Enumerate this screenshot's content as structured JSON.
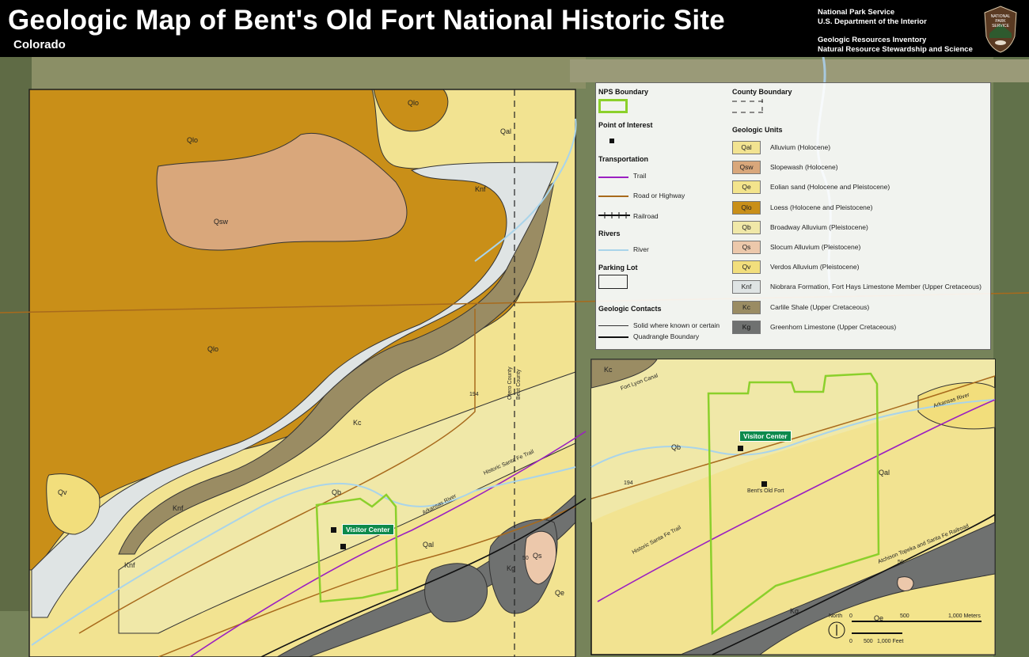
{
  "header": {
    "title": "Geologic Map of Bent's Old Fort National Historic Site",
    "subtitle": "Colorado",
    "agency_lines": [
      "National Park Service",
      "U.S. Department of the Interior"
    ],
    "program_lines": [
      "Geologic Resources Inventory",
      "Natural Resource Stewardship and Science"
    ],
    "badge_lines": [
      "NATIONAL",
      "PARK",
      "SERVICE"
    ]
  },
  "legend": {
    "nps_boundary": "NPS Boundary",
    "county_boundary": "County Boundary",
    "point_of_interest": "Point of Interest",
    "transportation": "Transportation",
    "trail": "Trail",
    "road": "Road or Highway",
    "railroad": "Railroad",
    "rivers": "Rivers",
    "river": "River",
    "parking_lot": "Parking Lot",
    "geologic_contacts": "Geologic Contacts",
    "contact_solid": "Solid where known or certain",
    "quadrangle": "Quadrangle Boundary",
    "geologic_units_title": "Geologic Units",
    "units": [
      {
        "code": "Qal",
        "desc": "Alluvium (Holocene)",
        "color": "#f2e391"
      },
      {
        "code": "Qsw",
        "desc": "Slopewash (Holocene)",
        "color": "#d9a77b"
      },
      {
        "code": "Qe",
        "desc": "Eolian sand (Holocene and Pleistocene)",
        "color": "#f3e48c"
      },
      {
        "code": "Qlo",
        "desc": "Loess (Holocene and Pleistocene)",
        "color": "#c98f18"
      },
      {
        "code": "Qb",
        "desc": "Broadway Alluvium (Pleistocene)",
        "color": "#f0e8a8"
      },
      {
        "code": "Qs",
        "desc": "Slocum Alluvium (Pleistocene)",
        "color": "#ecc8ab"
      },
      {
        "code": "Qv",
        "desc": "Verdos Alluvium (Pleistocene)",
        "color": "#f2de7c"
      },
      {
        "code": "Knf",
        "desc": "Niobrara Formation, Fort Hays Limestone Member (Upper Cretaceous)",
        "color": "#dfe4e4"
      },
      {
        "code": "Kc",
        "desc": "Carlile Shale (Upper Cretaceous)",
        "color": "#9a8c63"
      },
      {
        "code": "Kg",
        "desc": "Greenhorn Limestone (Upper Cretaceous)",
        "color": "#6f7170"
      }
    ]
  },
  "main_map": {
    "labels": [
      "Qlo",
      "Qal",
      "Qlo",
      "Knf",
      "Qsw",
      "Qlo",
      "Kc",
      "Qv",
      "Knf",
      "Knf",
      "Qb",
      "Qal",
      "Qs",
      "Kg",
      "Qe"
    ],
    "road_194": "194",
    "road_50": "50",
    "county_text_1": "Otero County",
    "county_text_2": "Bent County",
    "trail_label": "Historic Santa Fe Trail",
    "river_label": "Arkansas River",
    "visitor_center": "Visitor Center"
  },
  "inset_map": {
    "labels": [
      "Kc",
      "Qb",
      "Qal",
      "Kg",
      "Qe"
    ],
    "road_194": "194",
    "road_50": "50",
    "trail_label": "Historic Santa Fe Trail",
    "railroad_label": "Atchison Topeka and Santa Fe Railroad",
    "river_label": "Arkansas River",
    "canal_label": "Fort Lyon Canal",
    "visitor_center": "Visitor Center",
    "fort_label": "Bent's Old Fort",
    "scale": {
      "north": "North",
      "meters_ticks": [
        "0",
        "500",
        "1,000 Meters"
      ],
      "feet_ticks": [
        "0",
        "500",
        "1,000 Feet"
      ]
    }
  }
}
